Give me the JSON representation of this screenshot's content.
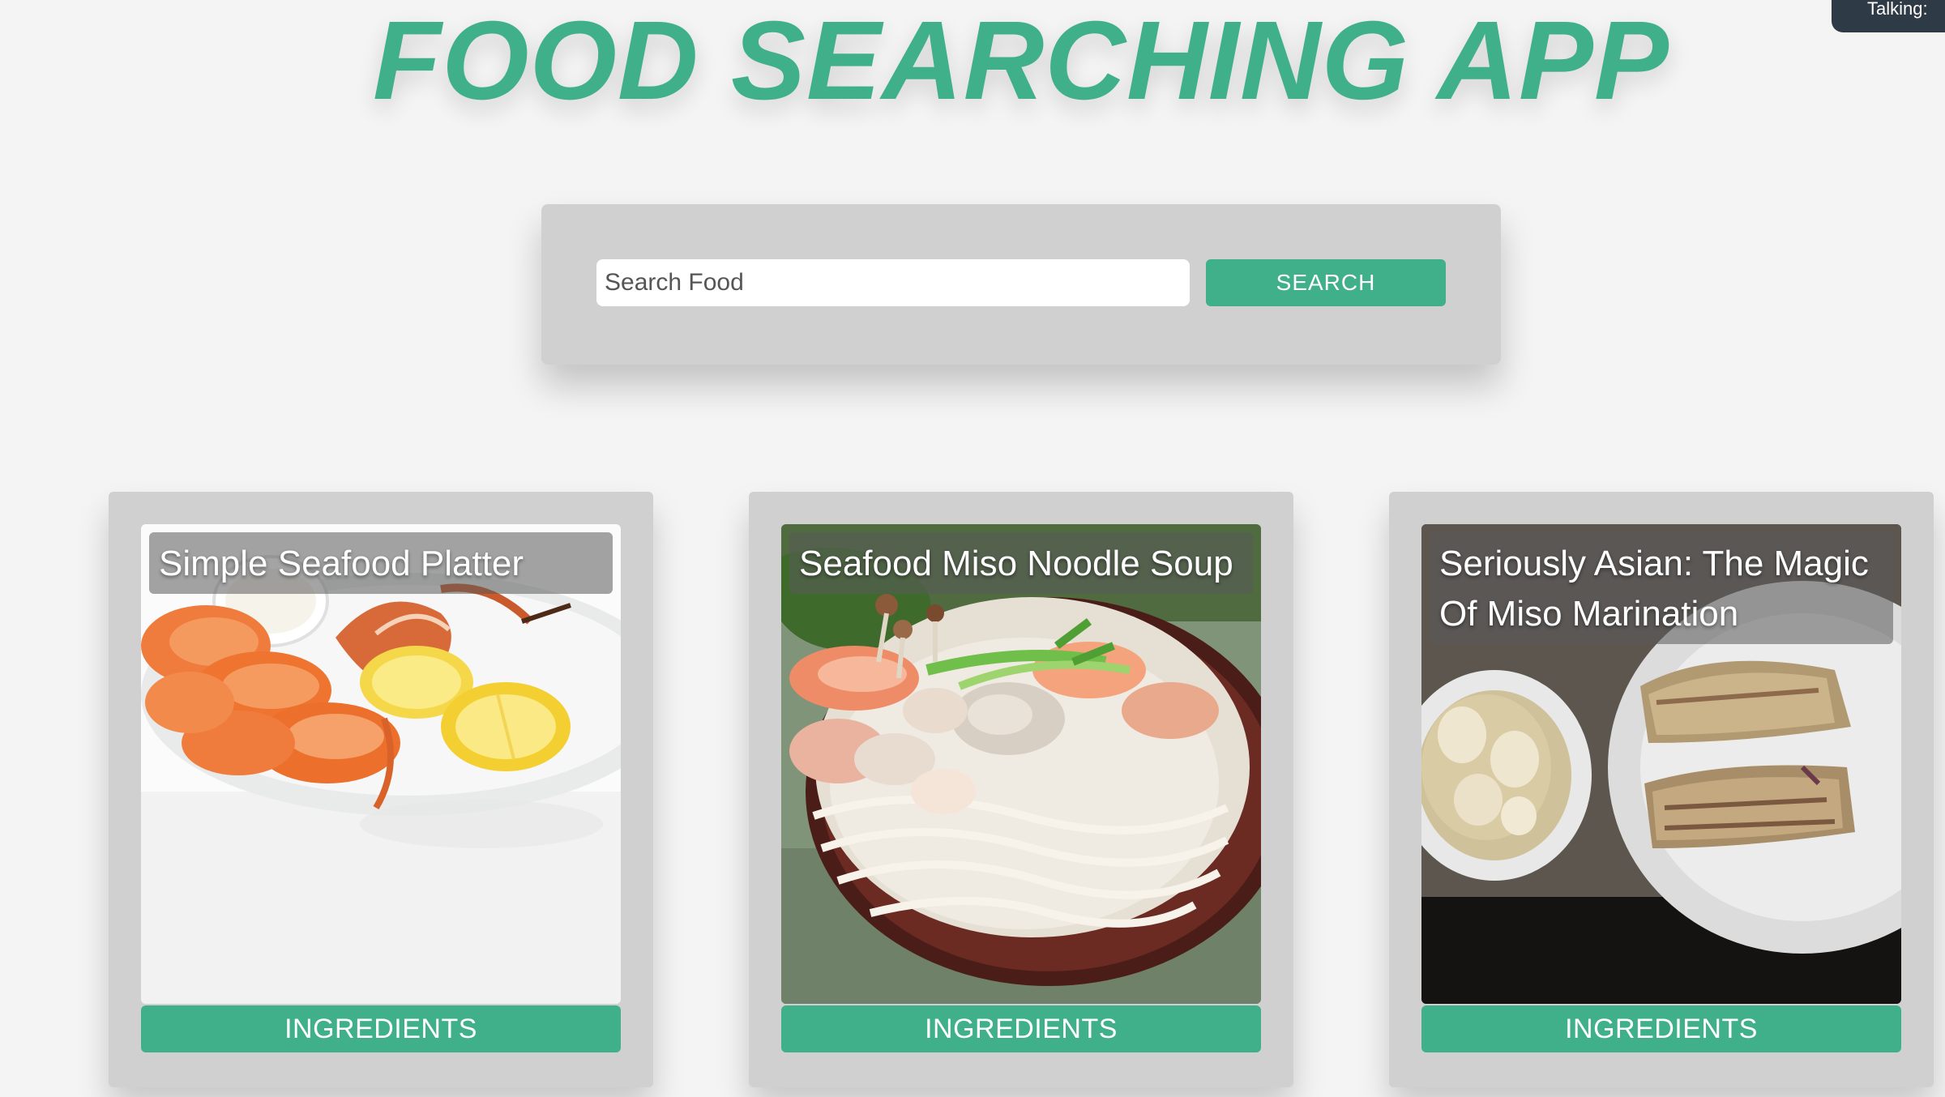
{
  "app": {
    "title": "FOOD SEARCHING APP",
    "corner_tab_text": "Talking:"
  },
  "search": {
    "placeholder": "Search Food",
    "value": "",
    "button_label": "SEARCH"
  },
  "results": [
    {
      "title": "Simple Seafood Platter",
      "button_label": "INGREDIENTS",
      "image_icon": "seafood-platter-photo"
    },
    {
      "title": "Seafood Miso Noodle Soup",
      "button_label": "INGREDIENTS",
      "image_icon": "noodle-soup-photo"
    },
    {
      "title": "Seriously Asian: The Magic Of Miso Marination",
      "button_label": "INGREDIENTS",
      "image_icon": "miso-marination-photo"
    }
  ],
  "colors": {
    "accent": "#40b08a",
    "panel": "#d0d0d0",
    "background": "#f4f4f4",
    "corner_tab": "#2e3a45"
  }
}
